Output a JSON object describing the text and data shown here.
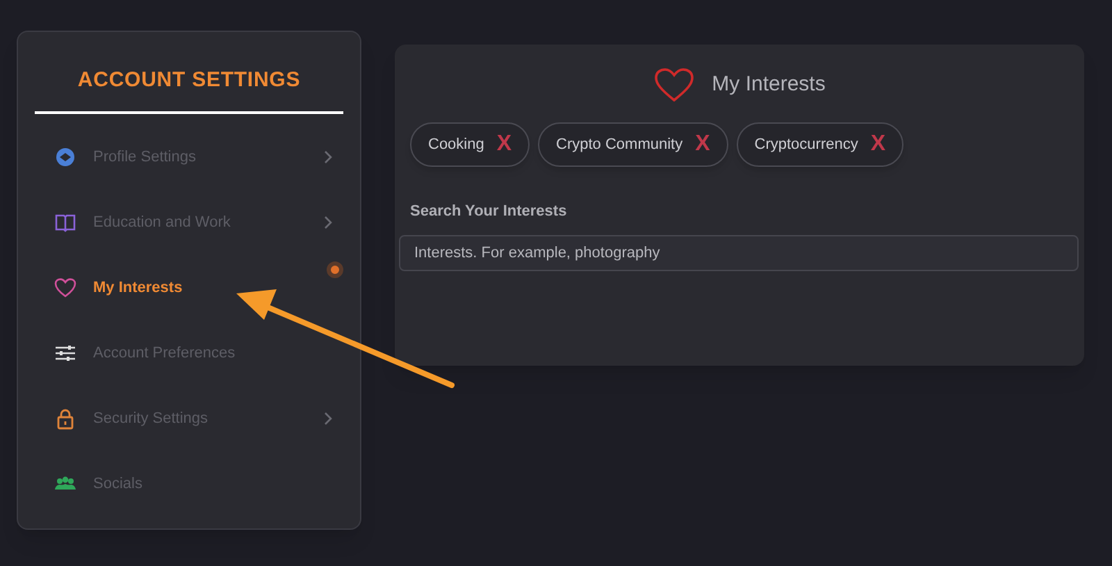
{
  "sidebar": {
    "title": "ACCOUNT SETTINGS",
    "items": [
      {
        "label": "Profile Settings",
        "selected": false,
        "chevron": true,
        "dot": false
      },
      {
        "label": "Education and Work",
        "selected": false,
        "chevron": true,
        "dot": false
      },
      {
        "label": "My Interests",
        "selected": true,
        "chevron": false,
        "dot": true
      },
      {
        "label": "Account Preferences",
        "selected": false,
        "chevron": false,
        "dot": false
      },
      {
        "label": "Security Settings",
        "selected": false,
        "chevron": true,
        "dot": false
      },
      {
        "label": "Socials",
        "selected": false,
        "chevron": false,
        "dot": false
      }
    ]
  },
  "panel": {
    "title": "My Interests",
    "tags": [
      {
        "label": "Cooking",
        "remove": "X"
      },
      {
        "label": "Crypto Community",
        "remove": "X"
      },
      {
        "label": "Cryptocurrency",
        "remove": "X"
      }
    ],
    "search_label": "Search Your Interests",
    "search": {
      "placeholder": "Interests. For example, photography"
    }
  },
  "annotation": {
    "arrow": true
  }
}
